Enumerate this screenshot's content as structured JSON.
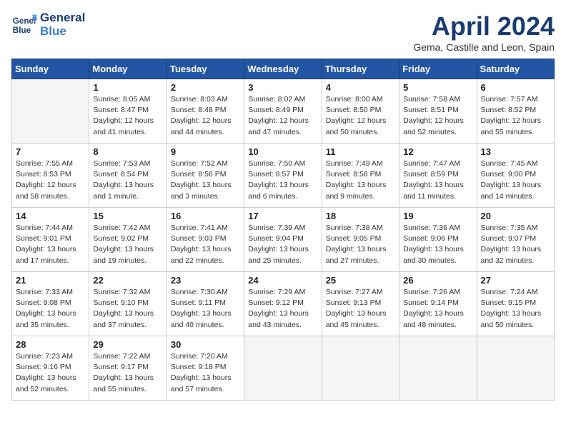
{
  "header": {
    "logo_line1": "General",
    "logo_line2": "Blue",
    "month_title": "April 2024",
    "location": "Gema, Castille and Leon, Spain"
  },
  "calendar": {
    "days_of_week": [
      "Sunday",
      "Monday",
      "Tuesday",
      "Wednesday",
      "Thursday",
      "Friday",
      "Saturday"
    ],
    "weeks": [
      [
        {
          "num": "",
          "empty": true
        },
        {
          "num": "1",
          "rise": "8:05 AM",
          "set": "8:47 PM",
          "daylight": "12 hours and 41 minutes."
        },
        {
          "num": "2",
          "rise": "8:03 AM",
          "set": "8:48 PM",
          "daylight": "12 hours and 44 minutes."
        },
        {
          "num": "3",
          "rise": "8:02 AM",
          "set": "8:49 PM",
          "daylight": "12 hours and 47 minutes."
        },
        {
          "num": "4",
          "rise": "8:00 AM",
          "set": "8:50 PM",
          "daylight": "12 hours and 50 minutes."
        },
        {
          "num": "5",
          "rise": "7:58 AM",
          "set": "8:51 PM",
          "daylight": "12 hours and 52 minutes."
        },
        {
          "num": "6",
          "rise": "7:57 AM",
          "set": "8:52 PM",
          "daylight": "12 hours and 55 minutes."
        }
      ],
      [
        {
          "num": "7",
          "rise": "7:55 AM",
          "set": "8:53 PM",
          "daylight": "12 hours and 58 minutes."
        },
        {
          "num": "8",
          "rise": "7:53 AM",
          "set": "8:54 PM",
          "daylight": "13 hours and 1 minute."
        },
        {
          "num": "9",
          "rise": "7:52 AM",
          "set": "8:56 PM",
          "daylight": "13 hours and 3 minutes."
        },
        {
          "num": "10",
          "rise": "7:50 AM",
          "set": "8:57 PM",
          "daylight": "13 hours and 6 minutes."
        },
        {
          "num": "11",
          "rise": "7:49 AM",
          "set": "8:58 PM",
          "daylight": "13 hours and 9 minutes."
        },
        {
          "num": "12",
          "rise": "7:47 AM",
          "set": "8:59 PM",
          "daylight": "13 hours and 11 minutes."
        },
        {
          "num": "13",
          "rise": "7:45 AM",
          "set": "9:00 PM",
          "daylight": "13 hours and 14 minutes."
        }
      ],
      [
        {
          "num": "14",
          "rise": "7:44 AM",
          "set": "9:01 PM",
          "daylight": "13 hours and 17 minutes."
        },
        {
          "num": "15",
          "rise": "7:42 AM",
          "set": "9:02 PM",
          "daylight": "13 hours and 19 minutes."
        },
        {
          "num": "16",
          "rise": "7:41 AM",
          "set": "9:03 PM",
          "daylight": "13 hours and 22 minutes."
        },
        {
          "num": "17",
          "rise": "7:39 AM",
          "set": "9:04 PM",
          "daylight": "13 hours and 25 minutes."
        },
        {
          "num": "18",
          "rise": "7:38 AM",
          "set": "9:05 PM",
          "daylight": "13 hours and 27 minutes."
        },
        {
          "num": "19",
          "rise": "7:36 AM",
          "set": "9:06 PM",
          "daylight": "13 hours and 30 minutes."
        },
        {
          "num": "20",
          "rise": "7:35 AM",
          "set": "9:07 PM",
          "daylight": "13 hours and 32 minutes."
        }
      ],
      [
        {
          "num": "21",
          "rise": "7:33 AM",
          "set": "9:08 PM",
          "daylight": "13 hours and 35 minutes."
        },
        {
          "num": "22",
          "rise": "7:32 AM",
          "set": "9:10 PM",
          "daylight": "13 hours and 37 minutes."
        },
        {
          "num": "23",
          "rise": "7:30 AM",
          "set": "9:11 PM",
          "daylight": "13 hours and 40 minutes."
        },
        {
          "num": "24",
          "rise": "7:29 AM",
          "set": "9:12 PM",
          "daylight": "13 hours and 43 minutes."
        },
        {
          "num": "25",
          "rise": "7:27 AM",
          "set": "9:13 PM",
          "daylight": "13 hours and 45 minutes."
        },
        {
          "num": "26",
          "rise": "7:26 AM",
          "set": "9:14 PM",
          "daylight": "13 hours and 48 minutes."
        },
        {
          "num": "27",
          "rise": "7:24 AM",
          "set": "9:15 PM",
          "daylight": "13 hours and 50 minutes."
        }
      ],
      [
        {
          "num": "28",
          "rise": "7:23 AM",
          "set": "9:16 PM",
          "daylight": "13 hours and 52 minutes."
        },
        {
          "num": "29",
          "rise": "7:22 AM",
          "set": "9:17 PM",
          "daylight": "13 hours and 55 minutes."
        },
        {
          "num": "30",
          "rise": "7:20 AM",
          "set": "9:18 PM",
          "daylight": "13 hours and 57 minutes."
        },
        {
          "num": "",
          "empty": true
        },
        {
          "num": "",
          "empty": true
        },
        {
          "num": "",
          "empty": true
        },
        {
          "num": "",
          "empty": true
        }
      ]
    ]
  }
}
